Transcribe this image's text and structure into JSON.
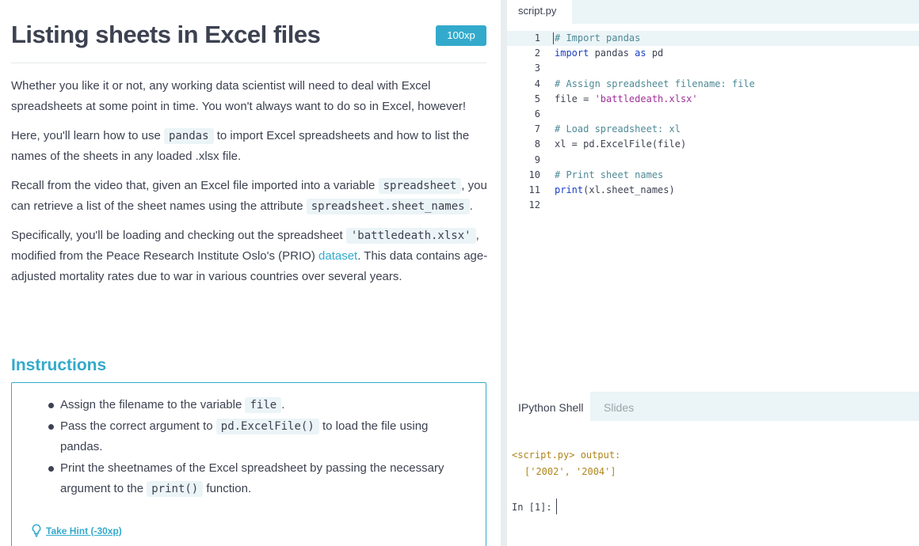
{
  "exercise": {
    "title": "Listing sheets in Excel files",
    "xp_badge": "100xp",
    "para1": "Whether you like it or not, any working data scientist will need to deal with Excel spreadsheets at some point in time. You won't always want to do so in Excel, however!",
    "para2_a": "Here, you'll learn how to use ",
    "para2_code": "pandas",
    "para2_b": " to import Excel spreadsheets and how to list the names of the sheets in any loaded .xlsx file.",
    "para3_a": "Recall from the video that, given an Excel file imported into a variable ",
    "para3_code1": "spreadsheet",
    "para3_b": ", you can retrieve a list of the sheet names using the attribute ",
    "para3_code2": "spreadsheet.sheet_names",
    "para3_c": ".",
    "para4_a": "Specifically, you'll be loading and checking out the spreadsheet ",
    "para4_code": "'battledeath.xlsx'",
    "para4_b": ", modified from the Peace Research Institute Oslo's (PRIO) ",
    "para4_link": "dataset",
    "para4_c": ". This data contains age-adjusted mortality rates due to war in various countries over several years.",
    "instructions_heading": "Instructions",
    "instructions": [
      {
        "a": "Assign the filename to the variable ",
        "code": "file",
        "b": "."
      },
      {
        "a": "Pass the correct argument to ",
        "code": "pd.ExcelFile()",
        "b": " to load the file using pandas."
      },
      {
        "a": "Print the sheetnames of the Excel spreadsheet by passing the necessary argument to the ",
        "code": "print()",
        "b": " function."
      }
    ],
    "hint_label": "Take Hint (-30xp)"
  },
  "editor": {
    "tab": "script.py",
    "lines": [
      {
        "n": "1",
        "parts": [
          {
            "t": "# Import pandas",
            "c": "comment"
          }
        ]
      },
      {
        "n": "2",
        "parts": [
          {
            "t": "import",
            "c": "kw"
          },
          {
            "t": " pandas ",
            "c": "plain"
          },
          {
            "t": "as",
            "c": "kw"
          },
          {
            "t": " pd",
            "c": "plain"
          }
        ]
      },
      {
        "n": "3",
        "parts": []
      },
      {
        "n": "4",
        "parts": [
          {
            "t": "# Assign spreadsheet filename: file",
            "c": "comment"
          }
        ]
      },
      {
        "n": "5",
        "parts": [
          {
            "t": "file = ",
            "c": "plain"
          },
          {
            "t": "'battledeath.xlsx'",
            "c": "str"
          }
        ]
      },
      {
        "n": "6",
        "parts": []
      },
      {
        "n": "7",
        "parts": [
          {
            "t": "# Load spreadsheet: xl",
            "c": "comment"
          }
        ]
      },
      {
        "n": "8",
        "parts": [
          {
            "t": "xl = pd.ExcelFile(file)",
            "c": "plain"
          }
        ]
      },
      {
        "n": "9",
        "parts": []
      },
      {
        "n": "10",
        "parts": [
          {
            "t": "# Print sheet names",
            "c": "comment"
          }
        ]
      },
      {
        "n": "11",
        "parts": [
          {
            "t": "print",
            "c": "kw"
          },
          {
            "t": "(xl.sheet_names)",
            "c": "plain"
          }
        ]
      },
      {
        "n": "12",
        "parts": []
      }
    ]
  },
  "shell": {
    "tab_active": "IPython Shell",
    "tab_other": "Slides",
    "output_line1": "<script.py> output:",
    "output_line2": "['2002', '2004']",
    "prompt": "In [1]:"
  },
  "colors": {
    "accent": "#33aacc",
    "code_bg": "#ebf4f7"
  }
}
